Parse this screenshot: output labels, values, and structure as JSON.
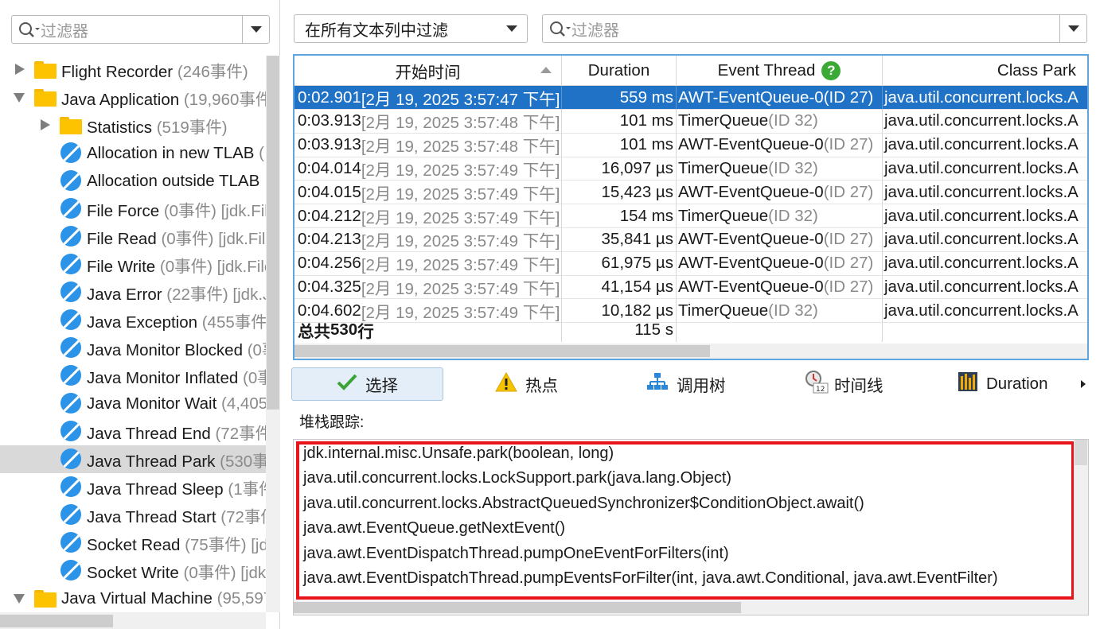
{
  "left_panel": {
    "filter_placeholder": "过滤器",
    "tree": [
      {
        "label": "Flight Recorder",
        "count": "(246事件)",
        "kind": "folder",
        "expander": "collapsed",
        "level": 0
      },
      {
        "label": "Java Application",
        "count": "(19,960事件",
        "kind": "folder",
        "expander": "expanded",
        "level": 0
      },
      {
        "label": "Statistics",
        "count": "(519事件)",
        "kind": "folder",
        "expander": "collapsed",
        "level": 1
      },
      {
        "label": "Allocation in new TLAB",
        "count": "(",
        "kind": "event",
        "level": 1
      },
      {
        "label": "Allocation outside TLAB",
        "count": "",
        "kind": "event",
        "level": 1
      },
      {
        "label": "File Force",
        "count": "(0事件) [jdk.File",
        "kind": "event",
        "level": 1
      },
      {
        "label": "File Read",
        "count": "(0事件) [jdk.File",
        "kind": "event",
        "level": 1
      },
      {
        "label": "File Write",
        "count": "(0事件) [jdk.File",
        "kind": "event",
        "level": 1
      },
      {
        "label": "Java Error",
        "count": "(22事件) [jdk.Ja",
        "kind": "event",
        "level": 1
      },
      {
        "label": "Java Exception",
        "count": "(455事件)",
        "kind": "event",
        "level": 1
      },
      {
        "label": "Java Monitor Blocked",
        "count": "(0事",
        "kind": "event",
        "level": 1
      },
      {
        "label": "Java Monitor Inflated",
        "count": "(0事",
        "kind": "event",
        "level": 1
      },
      {
        "label": "Java Monitor Wait",
        "count": "(4,405",
        "kind": "event",
        "level": 1
      },
      {
        "label": "Java Thread End",
        "count": "(72事件",
        "kind": "event",
        "level": 1
      },
      {
        "label": "Java Thread Park",
        "count": "(530事",
        "kind": "event",
        "level": 1,
        "selected": true
      },
      {
        "label": "Java Thread Sleep",
        "count": "(1事件",
        "kind": "event",
        "level": 1
      },
      {
        "label": "Java Thread Start",
        "count": "(72事件",
        "kind": "event",
        "level": 1
      },
      {
        "label": "Socket Read",
        "count": "(75事件) [jd",
        "kind": "event",
        "level": 1
      },
      {
        "label": "Socket Write",
        "count": "(0事件) [jdk",
        "kind": "event",
        "level": 1
      },
      {
        "label": "Java Virtual Machine",
        "count": "(95,597",
        "kind": "folder",
        "expander": "expanded",
        "level": 0
      }
    ]
  },
  "toolbar": {
    "filter_scope_value": "在所有文本列中过滤",
    "filter_placeholder": "过滤器"
  },
  "table": {
    "columns": [
      "开始时间",
      "Duration",
      "Event Thread",
      "Class Park"
    ],
    "rows": [
      {
        "time": "0:02.901",
        "date": "[2月 19, 2025 3:57:47 下午]",
        "duration": "559 ms",
        "thread": "AWT-EventQueue-0",
        "thread_id": "(ID 27)",
        "class": "java.util.concurrent.locks.A"
      },
      {
        "time": "0:03.913",
        "date": "[2月 19, 2025 3:57:48 下午]",
        "duration": "101 ms",
        "thread": "TimerQueue",
        "thread_id": "(ID 32)",
        "class": "java.util.concurrent.locks.A"
      },
      {
        "time": "0:03.913",
        "date": "[2月 19, 2025 3:57:48 下午]",
        "duration": "101 ms",
        "thread": "AWT-EventQueue-0",
        "thread_id": "(ID 27)",
        "class": "java.util.concurrent.locks.A"
      },
      {
        "time": "0:04.014",
        "date": "[2月 19, 2025 3:57:49 下午]",
        "duration": "16,097 µs",
        "thread": "TimerQueue",
        "thread_id": "(ID 32)",
        "class": "java.util.concurrent.locks.A"
      },
      {
        "time": "0:04.015",
        "date": "[2月 19, 2025 3:57:49 下午]",
        "duration": "15,423 µs",
        "thread": "AWT-EventQueue-0",
        "thread_id": "(ID 27)",
        "class": "java.util.concurrent.locks.A"
      },
      {
        "time": "0:04.212",
        "date": "[2月 19, 2025 3:57:49 下午]",
        "duration": "154 ms",
        "thread": "TimerQueue",
        "thread_id": "(ID 32)",
        "class": "java.util.concurrent.locks.A"
      },
      {
        "time": "0:04.213",
        "date": "[2月 19, 2025 3:57:49 下午]",
        "duration": "35,841 µs",
        "thread": "AWT-EventQueue-0",
        "thread_id": "(ID 27)",
        "class": "java.util.concurrent.locks.A"
      },
      {
        "time": "0:04.256",
        "date": "[2月 19, 2025 3:57:49 下午]",
        "duration": "61,975 µs",
        "thread": "AWT-EventQueue-0",
        "thread_id": "(ID 27)",
        "class": "java.util.concurrent.locks.A"
      },
      {
        "time": "0:04.325",
        "date": "[2月 19, 2025 3:57:49 下午]",
        "duration": "41,154 µs",
        "thread": "AWT-EventQueue-0",
        "thread_id": "(ID 27)",
        "class": "java.util.concurrent.locks.A"
      },
      {
        "time": "0:04.602",
        "date": "[2月 19, 2025 3:57:49 下午]",
        "duration": "10,182 µs",
        "thread": "TimerQueue",
        "thread_id": "(ID 32)",
        "class": "java.util.concurrent.locks.A"
      }
    ],
    "footer": {
      "total_prefix": "总共",
      "total_count": "530",
      "total_suffix": "行",
      "duration_total": "115 s"
    }
  },
  "tabs": [
    {
      "label": "选择",
      "icon": "check-icon",
      "active": true
    },
    {
      "label": "热点",
      "icon": "warning-icon"
    },
    {
      "label": "调用树",
      "icon": "call-tree-icon"
    },
    {
      "label": "时间线",
      "icon": "timeline-icon"
    },
    {
      "label": "Duration",
      "icon": "duration-icon"
    }
  ],
  "stack": {
    "label": "堆栈跟踪:",
    "frames": [
      "jdk.internal.misc.Unsafe.park(boolean, long)",
      "java.util.concurrent.locks.LockSupport.park(java.lang.Object)",
      "java.util.concurrent.locks.AbstractQueuedSynchronizer$ConditionObject.await()",
      "java.awt.EventQueue.getNextEvent()",
      "java.awt.EventDispatchThread.pumpOneEventForFilters(int)",
      "java.awt.EventDispatchThread.pumpEventsForFilter(int, java.awt.Conditional, java.awt.EventFilter)"
    ]
  },
  "colors": {
    "selection": "#1f72c6",
    "highlight_border": "#e8141a",
    "help_badge": "#3aaa35",
    "event_icon": "#2b93e8",
    "folder": "#fdc300"
  }
}
